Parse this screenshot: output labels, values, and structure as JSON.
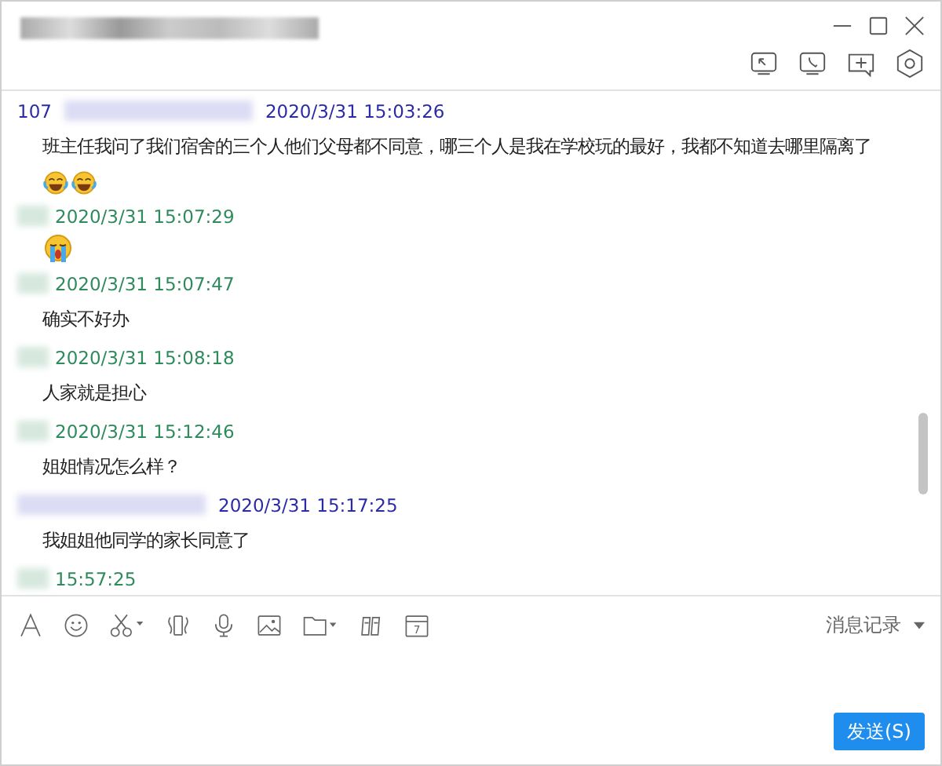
{
  "messages": [
    {
      "header": {
        "kind": "other",
        "prefix": "107",
        "time": "2020/3/31 15:03:26"
      },
      "kind": "text",
      "text": "班主任我问了我们宿舍的三个人他们父母都不同意，哪三个人是我在学校玩的最好，我都不知道去哪里隔离了",
      "emoji": [
        {
          "kind": "laugh-cry"
        },
        {
          "kind": "laugh-cry"
        }
      ]
    },
    {
      "header": {
        "kind": "self",
        "time": "2020/3/31 15:07:29"
      },
      "kind": "emoji",
      "emoji": [
        {
          "kind": "crying"
        }
      ]
    },
    {
      "header": {
        "kind": "self",
        "time": "2020/3/31 15:07:47"
      },
      "kind": "text",
      "text": "确实不好办"
    },
    {
      "header": {
        "kind": "self",
        "time": "2020/3/31 15:08:18"
      },
      "kind": "text",
      "text": "人家就是担心"
    },
    {
      "header": {
        "kind": "self",
        "time": "2020/3/31 15:12:46"
      },
      "kind": "text",
      "text": "姐姐情况怎么样？"
    },
    {
      "header": {
        "kind": "other",
        "time": "2020/3/31 15:17:25"
      },
      "kind": "text",
      "text": "我姐姐他同学的家长同意了"
    },
    {
      "header": {
        "kind": "self",
        "time": "15:57:25"
      },
      "kind": "none"
    }
  ],
  "toolbar": {
    "calendar_day": "7",
    "history": "消息记录"
  },
  "send_button": "发送(S)"
}
